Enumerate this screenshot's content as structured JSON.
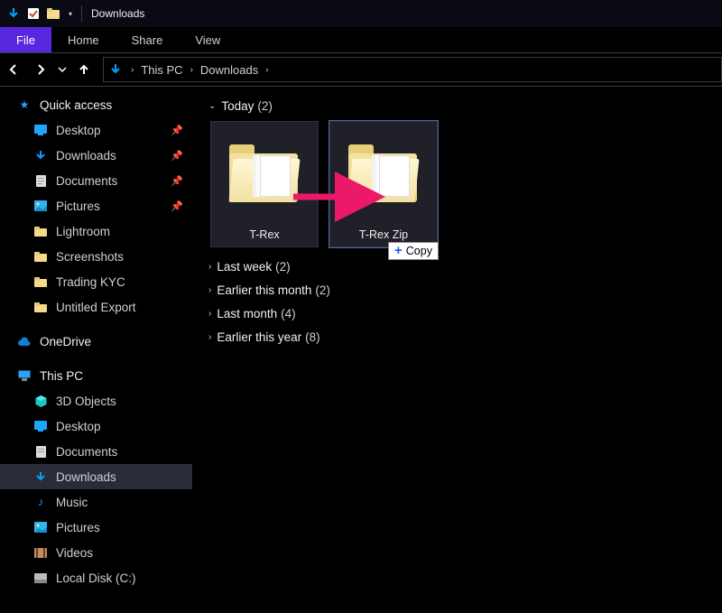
{
  "titlebar": {
    "title": "Downloads"
  },
  "ribbon": {
    "file": "File",
    "home": "Home",
    "share": "Share",
    "view": "View"
  },
  "nav": {
    "breadcrumb": {
      "root_chev": "›",
      "this_pc": "This PC",
      "folder": "Downloads"
    }
  },
  "sidebar": {
    "quick_access": {
      "label": "Quick access",
      "items": [
        {
          "icon": "desktop",
          "label": "Desktop",
          "pinned": true
        },
        {
          "icon": "download",
          "label": "Downloads",
          "pinned": true
        },
        {
          "icon": "doc",
          "label": "Documents",
          "pinned": true
        },
        {
          "icon": "picture",
          "label": "Pictures",
          "pinned": true
        },
        {
          "icon": "folder",
          "label": "Lightroom",
          "pinned": false
        },
        {
          "icon": "folder",
          "label": "Screenshots",
          "pinned": false
        },
        {
          "icon": "folder",
          "label": "Trading KYC",
          "pinned": false
        },
        {
          "icon": "folder",
          "label": "Untitled Export",
          "pinned": false
        }
      ]
    },
    "onedrive": {
      "label": "OneDrive"
    },
    "this_pc": {
      "label": "This PC",
      "items": [
        {
          "icon": "3d",
          "label": "3D Objects"
        },
        {
          "icon": "desktop",
          "label": "Desktop"
        },
        {
          "icon": "doc",
          "label": "Documents"
        },
        {
          "icon": "download",
          "label": "Downloads",
          "selected": true
        },
        {
          "icon": "music",
          "label": "Music"
        },
        {
          "icon": "picture",
          "label": "Pictures"
        },
        {
          "icon": "video",
          "label": "Videos"
        },
        {
          "icon": "disk",
          "label": "Local Disk (C:)"
        }
      ]
    }
  },
  "content": {
    "today": {
      "label": "Today",
      "count": "(2)",
      "expanded": true,
      "items": [
        {
          "name": "T-Rex"
        },
        {
          "name": "T-Rex Zip"
        }
      ]
    },
    "groups": [
      {
        "label": "Last week",
        "count": "(2)"
      },
      {
        "label": "Earlier this month",
        "count": "(2)"
      },
      {
        "label": "Last month",
        "count": "(4)"
      },
      {
        "label": "Earlier this year",
        "count": "(8)"
      }
    ]
  },
  "drag": {
    "tooltip": "Copy",
    "plus": "+"
  }
}
